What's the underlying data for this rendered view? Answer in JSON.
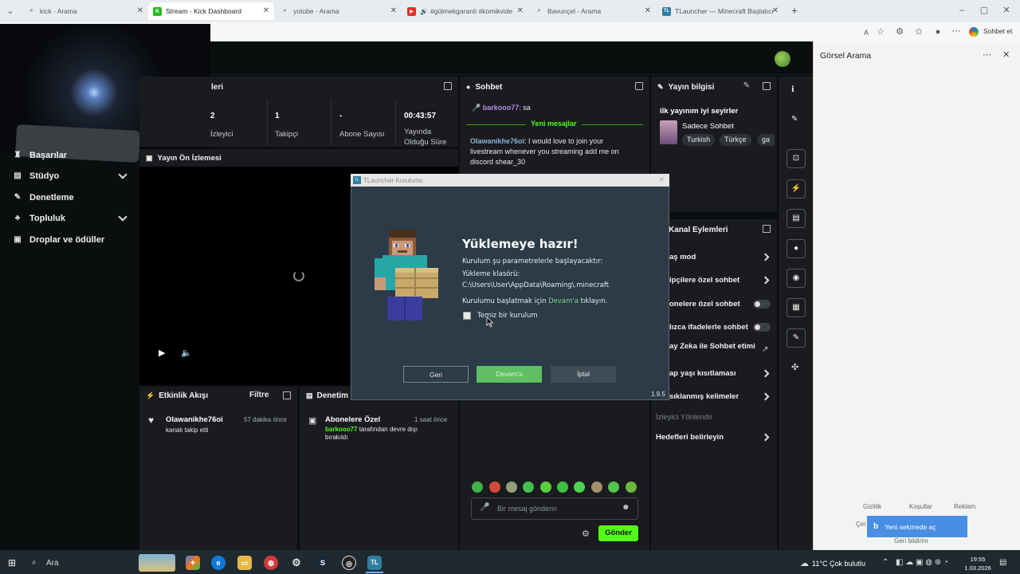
{
  "browser": {
    "tabs": [
      {
        "label": "kick - Arama",
        "icon": "search-icon"
      },
      {
        "label": "Stream - Kick Dashboard",
        "icon": "kick-logo-icon"
      },
      {
        "label": "yotube - Arama",
        "icon": "search-icon"
      },
      {
        "label": "#gülmekgaranti #komikvide",
        "icon": "youtube-icon"
      },
      {
        "label": "Bavunçel - Arama",
        "icon": "search-icon"
      },
      {
        "label": "TLauncher — Minecraft Başlatıcı",
        "icon": "tlauncher-icon"
      }
    ],
    "new_tab_label": "+",
    "copilot_label": "Sohbet et"
  },
  "kick": {
    "stats_header": "leri",
    "stats": [
      {
        "value": "2",
        "label": "İzleyici"
      },
      {
        "value": "1",
        "label": "Takipçi"
      },
      {
        "value": "-",
        "label": "Abone Sayısı"
      },
      {
        "value": "00:43:57",
        "label": "Yayında Olduğu Süre"
      }
    ],
    "nav": [
      {
        "label": "Başarılar",
        "icon": "trophy-icon",
        "expandable": false
      },
      {
        "label": "Stüdyo",
        "icon": "studio-icon",
        "expandable": true
      },
      {
        "label": "Denetleme",
        "icon": "wrench-icon",
        "expandable": false
      },
      {
        "label": "Topluluk",
        "icon": "community-icon",
        "expandable": true
      },
      {
        "label": "Droplar ve ödüller",
        "icon": "gift-icon",
        "expandable": false
      }
    ],
    "preview_title": "Yayın Ön İzlemesi",
    "chat": {
      "title": "Sohbet",
      "messages": [
        {
          "user": "barkooo77",
          "text": "sa",
          "user_color": "#b48ee8"
        },
        {
          "user": "Olawanikhe76oi",
          "text": "I would love to join your livestream whenever you streaming add me on discord shear_30",
          "user_color": "#8ab4d8"
        }
      ],
      "new_messages_label": "Yeni mesajlar",
      "input_placeholder": "Bir mesaj gönderin",
      "send_label": "Gönder"
    },
    "stream_info": {
      "title": "Yayın bilgisi",
      "stream_title": "ilk yayınım iyi seyirler",
      "category": "Sadece Sohbet",
      "tags": [
        "Turkish",
        "Türkçe",
        "ga"
      ]
    },
    "channel_actions": {
      "title": "Kanal Eylemleri",
      "items": [
        {
          "label": "aş mod",
          "control": "chevron"
        },
        {
          "label": "ipçilere özel sohbet",
          "control": "chevron"
        },
        {
          "label": "onelere özel sohbet",
          "control": "toggle"
        },
        {
          "label": "lızca ifadelerle sohbet",
          "control": "toggle"
        },
        {
          "label": "ay Zeka ile Sohbet etimi",
          "control": "external"
        },
        {
          "label": "ap yaşı kısıtlaması",
          "control": "chevron"
        },
        {
          "label": "sıklanmış kelimeler",
          "control": "chevron"
        },
        {
          "label": "İzleyici Yönlendir",
          "control": "none"
        },
        {
          "label": "Hedefleri belirleyin",
          "control": "chevron"
        }
      ]
    },
    "activity": {
      "title": "Etkinlik Akışı",
      "filter_label": "Filtre",
      "items": [
        {
          "user": "Olawanikhe76oi",
          "text": "kanalı takip etti",
          "time": "57 dakika önce"
        }
      ]
    },
    "audit": {
      "title": "Denetim E",
      "items": [
        {
          "title": "Abonelere Özel",
          "user": "barkooo77",
          "text": "tarafından devre dışı bırakıldı",
          "time": "1 saat önce"
        }
      ]
    }
  },
  "side_panel": {
    "title": "Görsel Arama",
    "links": [
      "Gizlilik",
      "Koşullar",
      "Reklam"
    ],
    "open_tab_label": "Yeni sekmede aç",
    "feedback_label": "Geri bildirim",
    "cer_label": "Çer"
  },
  "tlauncher": {
    "window_title": "TLauncher Kurulumu",
    "heading": "Yüklemeye hazır!",
    "line1": "Kurulum şu parametrelerle başlayacaktır:",
    "line2": "Yükleme klasörü:",
    "path": "C:\\Users\\User\\AppData\\Roaming\\.minecraft",
    "line3_pre": "Kurulumu başlatmak için ",
    "line3_link": "Devam'a",
    "line3_post": " tıklayın.",
    "checkbox_label": "Temiz bir kurulum",
    "checkbox_checked": false,
    "btn_back": "Geri",
    "btn_continue": "Devam'a",
    "btn_cancel": "İptal",
    "version": "1.9.5"
  },
  "taskbar": {
    "search_label": "Ara",
    "weather": "11°C  Çok bulutlu",
    "time": "19:55",
    "date": "1.03.2026"
  }
}
